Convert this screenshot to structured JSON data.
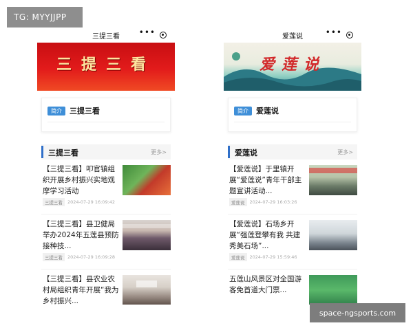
{
  "watermarks": {
    "top": "TG: MYYJJPP",
    "bottom": "space-ngsports.com"
  },
  "phones": [
    {
      "nav_title": "三提三看",
      "nav_more": "•••",
      "banner_text": "三提三看",
      "intro_tag": "简介",
      "intro_name": "三提三看",
      "section_title": "三提三看",
      "section_more": "更多>",
      "articles": [
        {
          "title": "【三提三看】叩官镇组织开展乡村振兴实地观摩学习活动",
          "category": "三提三看",
          "time": "2024-07-29 16:09:42",
          "thumb": "fruit-orchard"
        },
        {
          "title": "【三提三看】县卫健局举办2024年五莲县预防接种技...",
          "category": "三提三看",
          "time": "2024-07-29 16:09:28",
          "thumb": "meeting-hall"
        },
        {
          "title": "【三提三看】县农业农村局组织青年开展“我为乡村振兴...",
          "category": "",
          "time": "",
          "thumb": "meeting-room"
        }
      ]
    },
    {
      "nav_title": "爱莲说",
      "nav_more": "•••",
      "banner_text": "爱莲说",
      "intro_tag": "简介",
      "intro_name": "爱莲说",
      "section_title": "爱莲说",
      "section_more": "更多>",
      "articles": [
        {
          "title": "【爱莲说】于里镇开展“爱莲说”青年干部主题宣讲活动...",
          "category": "爱莲说",
          "time": "2024-07-29 16:03:26",
          "thumb": "conference"
        },
        {
          "title": "【爱莲说】石场乡开展“强莲登攀有我 共建秀美石场”...",
          "category": "爱莲说",
          "time": "2024-07-29 15:59:46",
          "thumb": "office"
        },
        {
          "title": "五莲山风景区对全国游客免首道大门票...",
          "category": "",
          "time": "",
          "thumb": "scenic"
        }
      ]
    }
  ]
}
